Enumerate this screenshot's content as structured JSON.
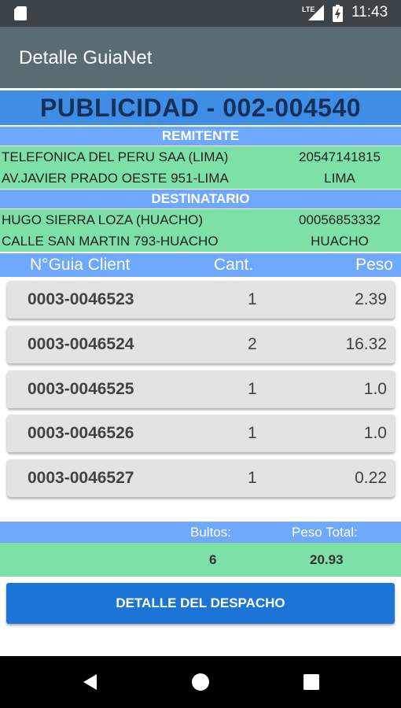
{
  "status_bar": {
    "time": "11:43",
    "network": "LTE"
  },
  "app_bar": {
    "title": "Detalle GuiaNet"
  },
  "header": {
    "title": "PUBLICIDAD - 002-004540"
  },
  "sender": {
    "heading": "REMITENTE",
    "name": "TELEFONICA DEL PERU SAA (LIMA)",
    "id": "20547141815",
    "address": "AV.JAVIER PRADO OESTE 951-LIMA",
    "city": "LIMA"
  },
  "recipient": {
    "heading": "DESTINATARIO",
    "name": "HUGO SIERRA LOZA (HUACHO)",
    "id": "00056853332",
    "address": "CALLE SAN MARTIN 793-HUACHO",
    "city": "HUACHO"
  },
  "table": {
    "columns": [
      "N°Guia Client",
      "Cant.",
      "Peso"
    ],
    "rows": [
      {
        "guia": "0003-0046523",
        "cant": "1",
        "peso": "2.39"
      },
      {
        "guia": "0003-0046524",
        "cant": "2",
        "peso": "16.32"
      },
      {
        "guia": "0003-0046525",
        "cant": "1",
        "peso": "1.0"
      },
      {
        "guia": "0003-0046526",
        "cant": "1",
        "peso": "1.0"
      },
      {
        "guia": "0003-0046527",
        "cant": "1",
        "peso": "0.22"
      }
    ]
  },
  "totals": {
    "bultos_label": "Bultos:",
    "peso_label": "Peso Total:",
    "bultos": "6",
    "peso_total": "20.93"
  },
  "action": {
    "label": "DETALLE DEL DESPACHO"
  },
  "colors": {
    "app_bar": "#5b6b72",
    "title_bar": "#3f8de4",
    "section_blue": "#6ea8ff",
    "section_green": "#7de0a7",
    "button": "#1c75d6"
  },
  "icons": {
    "nav": [
      "back-icon",
      "home-icon",
      "recents-icon"
    ],
    "status": [
      "sd-card-icon",
      "signal-icon",
      "battery-icon"
    ]
  }
}
